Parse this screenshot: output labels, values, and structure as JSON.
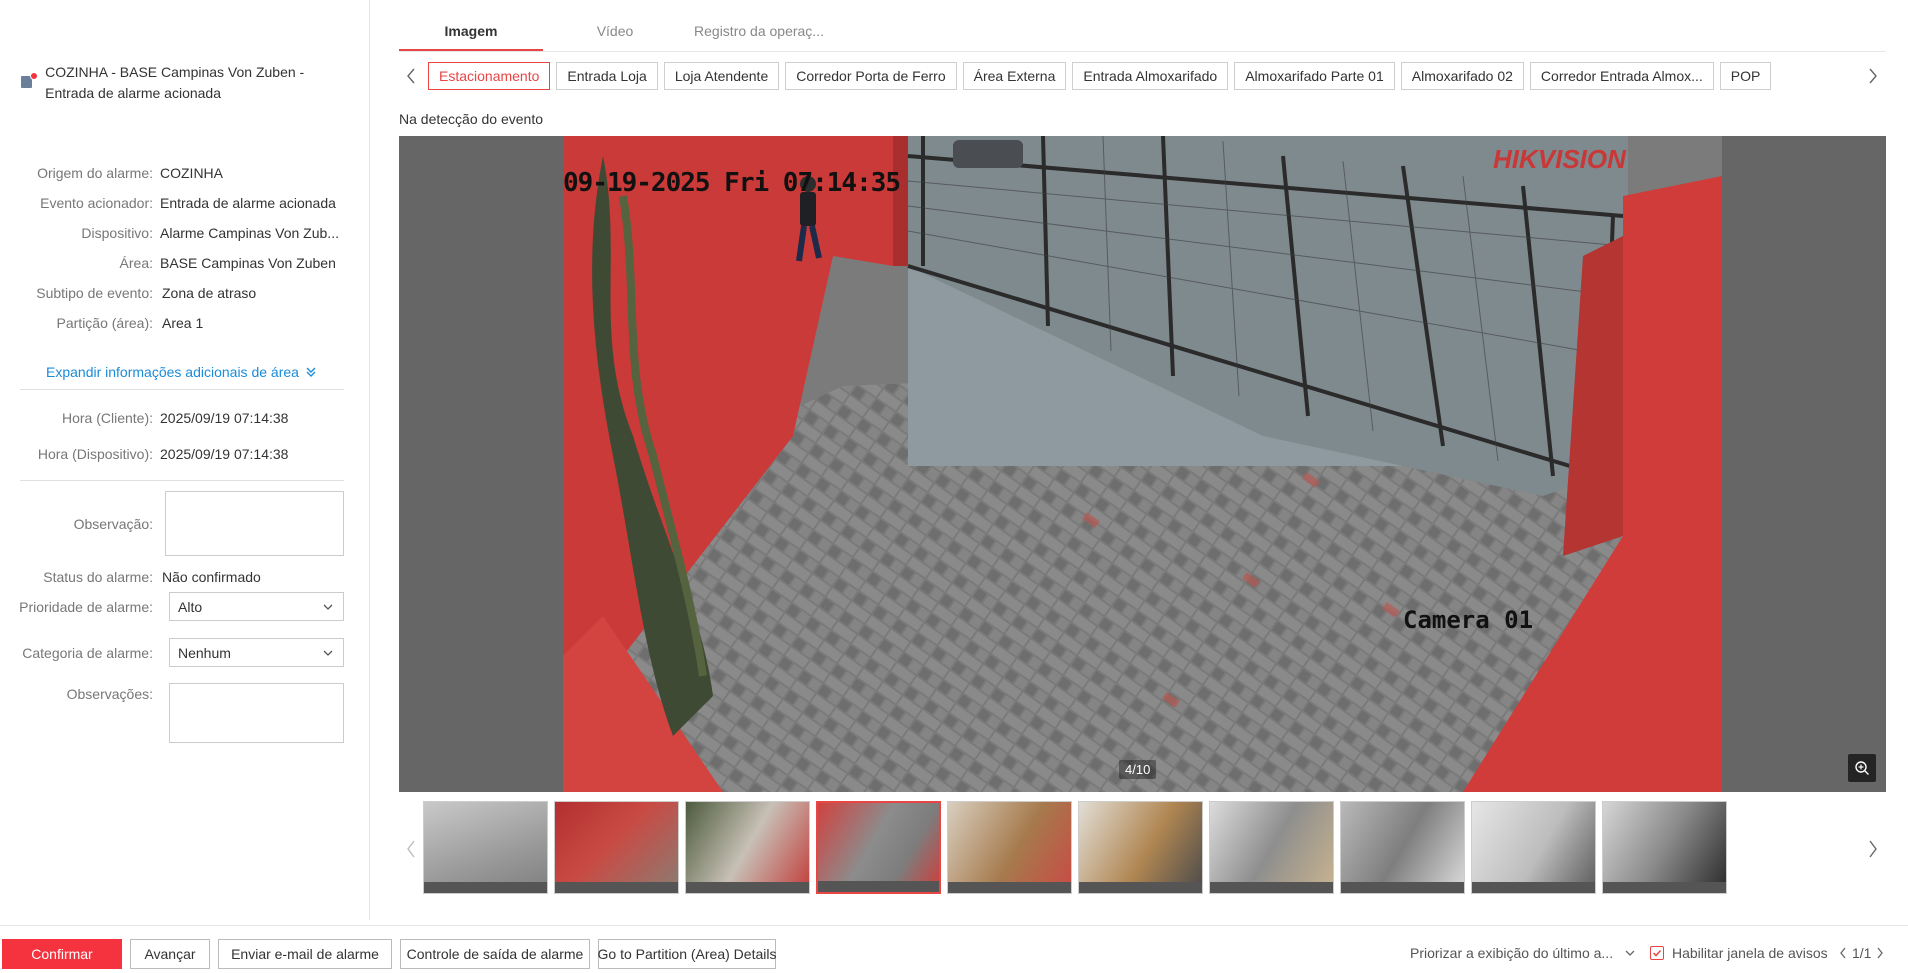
{
  "alarm": {
    "title": "COZINHA - BASE Campinas Von Zuben - Entrada de alarme acionada"
  },
  "details": [
    {
      "label": "Origem do alarme:",
      "value": "COZINHA"
    },
    {
      "label": "Evento acionador:",
      "value": "Entrada de alarme acionada"
    },
    {
      "label": "Dispositivo:",
      "value": "Alarme Campinas Von Zub..."
    },
    {
      "label": "Área:",
      "value": "BASE Campinas Von Zuben"
    },
    {
      "label": "Subtipo de evento:",
      "value": "Zona de atraso"
    },
    {
      "label": "Partição (área):",
      "value": "Area 1"
    }
  ],
  "expand_link": "Expandir informações adicionais de área",
  "times": [
    {
      "label": "Hora (Cliente):",
      "value": "2025/09/19 07:14:38"
    },
    {
      "label": "Hora (Dispositivo):",
      "value": "2025/09/19 07:14:38"
    }
  ],
  "form": {
    "observacao_label": "Observação:",
    "status_label": "Status do alarme:",
    "status_value": "Não confirmado",
    "priority_label": "Prioridade de alarme:",
    "priority_value": "Alto",
    "category_label": "Categoria de alarme:",
    "category_value": "Nenhum",
    "observacoes_label": "Observações:"
  },
  "tabs": [
    "Imagem",
    "Vídeo",
    "Registro da operaç..."
  ],
  "cameras": [
    "Estacionamento",
    "Entrada Loja",
    "Loja Atendente",
    "Corredor Porta de Ferro",
    "Área Externa",
    "Entrada Almoxarifado",
    "Almoxarifado Parte 01",
    "Almoxarifado 02",
    "Corredor Entrada Almox...",
    "POP"
  ],
  "event_label": "Na detecção do evento",
  "image": {
    "osd_time": "09-19-2025 Fri 07:14:35",
    "osd_camera": "Camera 01",
    "osd_brand": "HIKVISION",
    "counter": "4/10",
    "active_thumbnail": 4,
    "thumbnail_count": 10
  },
  "bottom": {
    "confirm": "Confirmar",
    "advance": "Avançar",
    "email": "Enviar e-mail de alarme",
    "exit_control": "Controle de saída de alarme",
    "partition_details": "Go to Partition (Area) Details",
    "prioritize": "Priorizar a exibição do último a...",
    "enable_window": "Habilitar janela de avisos",
    "pagination": "1/1"
  },
  "colors": {
    "accent": "#f5333f",
    "link": "#1a8cd8",
    "tab_underline": "#e84545"
  }
}
